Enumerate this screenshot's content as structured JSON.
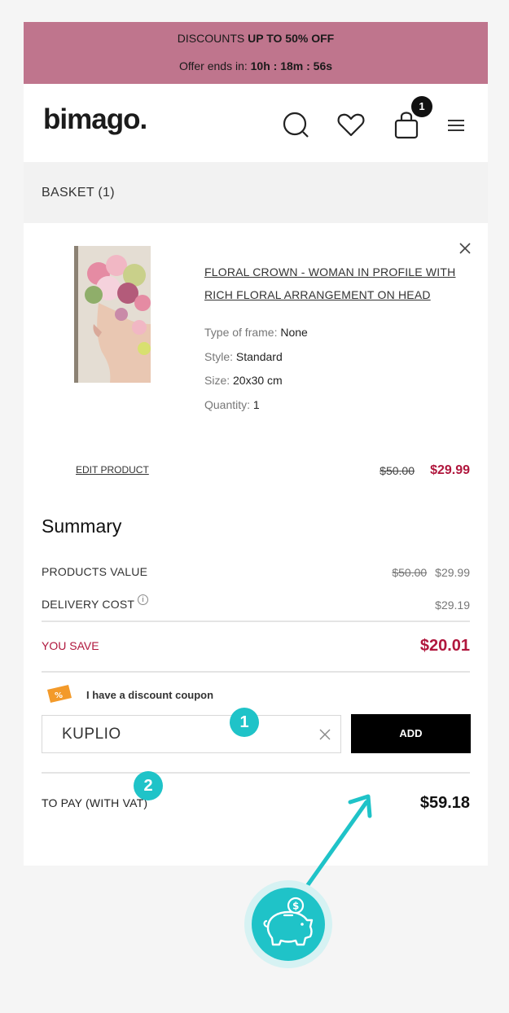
{
  "promo": {
    "line1_prefix": "DISCOUNTS ",
    "line1_bold": "UP TO 50% OFF",
    "line2_prefix": "Offer ends in: ",
    "line2_bold": "10h : 18m : 56s"
  },
  "header": {
    "logo": "bimago.",
    "cart_count": "1",
    "icons": [
      "search-icon",
      "heart-icon",
      "shopping-bag-icon",
      "menu-icon"
    ]
  },
  "basket": {
    "title": "BASKET (1)"
  },
  "product": {
    "title": "FLORAL CROWN - WOMAN IN PROFILE WITH RICH FLORAL ARRANGEMENT ON HEAD",
    "attributes": [
      {
        "label": "Type of frame: ",
        "value": "None"
      },
      {
        "label": "Style: ",
        "value": "Standard"
      },
      {
        "label": "Size: ",
        "value": "20x30 cm"
      },
      {
        "label": "Quantity: ",
        "value": "1"
      }
    ],
    "edit_label": "EDIT PRODUCT",
    "old_price": "$50.00",
    "new_price": "$29.99"
  },
  "summary": {
    "title": "Summary",
    "products_value_label": "PRODUCTS VALUE",
    "products_value_old": "$50.00",
    "products_value_new": "$29.99",
    "delivery_label": "DELIVERY COST",
    "delivery_info": "i",
    "delivery_value": "$29.19",
    "save_label": "YOU SAVE",
    "save_value": "$20.01",
    "coupon_label": "I have a discount coupon",
    "coupon_value": "KUPLIO",
    "add_label": "ADD",
    "pay_label": "TO PAY (WITH VAT)",
    "pay_value": "$59.18"
  },
  "markers": {
    "m1": "1",
    "m2": "2"
  },
  "colors": {
    "promo_bg": "#bf758d",
    "price_red": "#b0173d",
    "accent_teal": "#1fc3c8",
    "coupon_orange": "#f39a2a"
  }
}
